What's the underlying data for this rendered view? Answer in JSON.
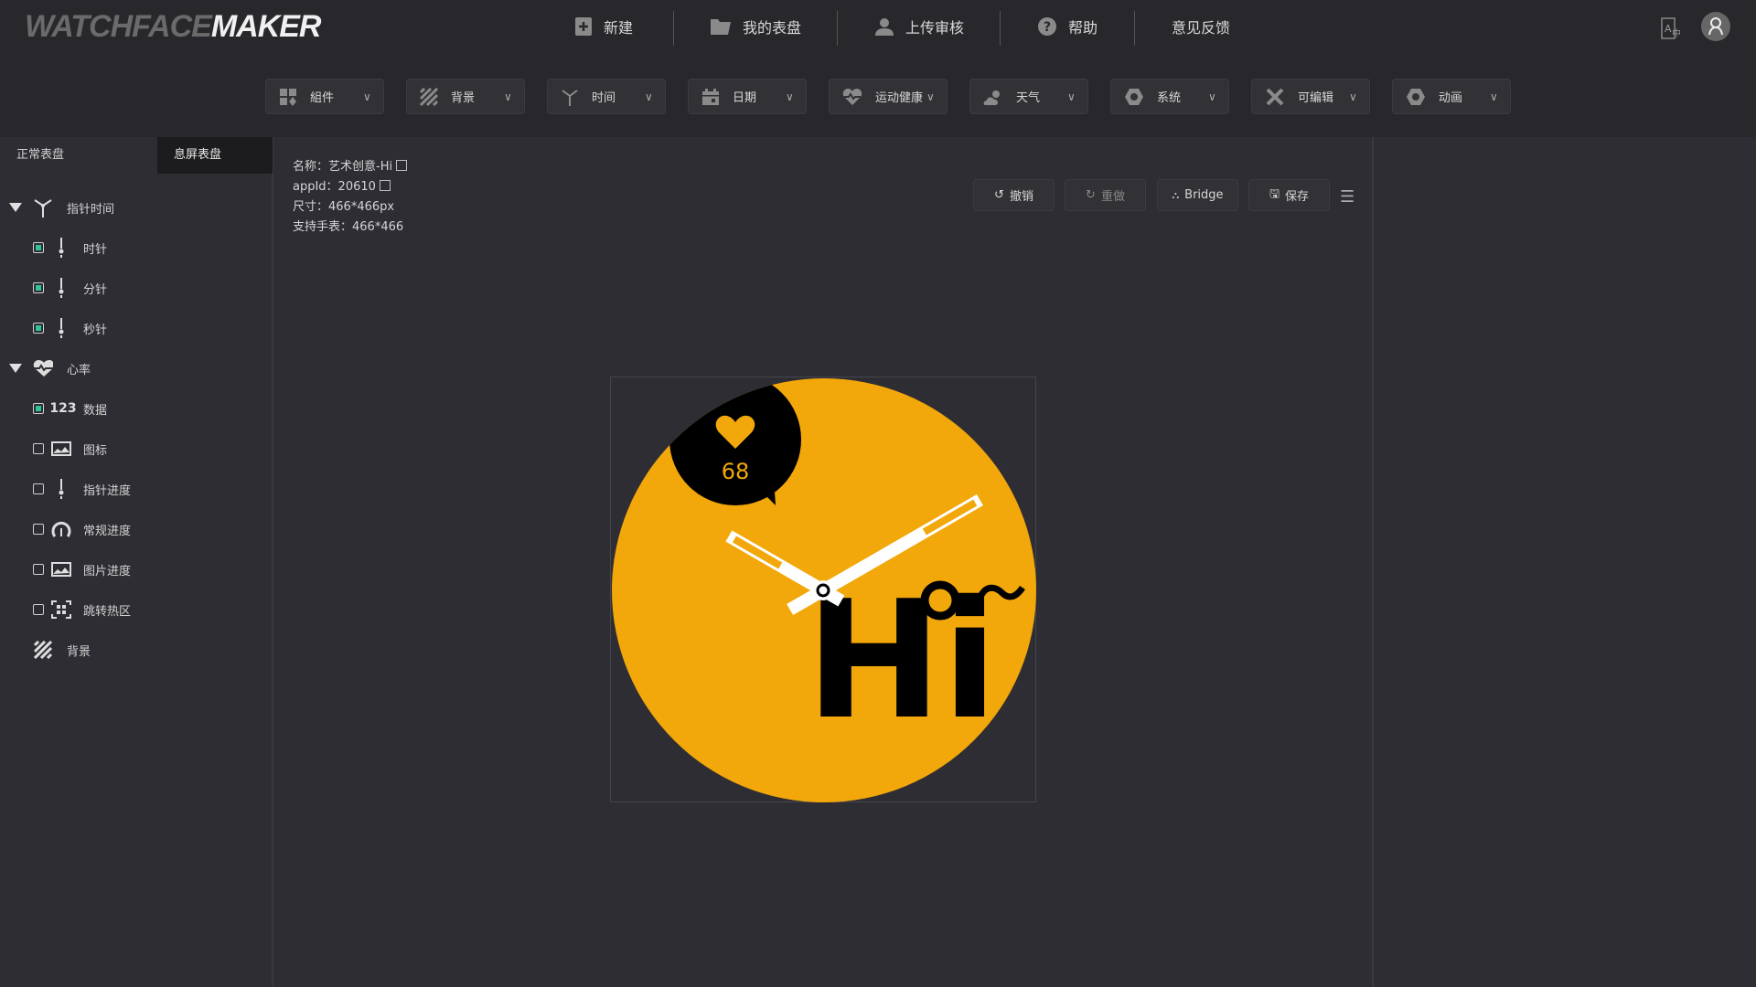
{
  "header": {
    "logo_light": "WATCHFACE",
    "logo_bold": "MAKER",
    "nav": [
      {
        "label": "新建",
        "icon": "plus-file-icon"
      },
      {
        "label": "我的表盘",
        "icon": "folder-icon"
      },
      {
        "label": "上传审核",
        "icon": "user-icon"
      },
      {
        "label": "帮助",
        "icon": "help-icon"
      },
      {
        "label": "意见反馈"
      }
    ]
  },
  "toolbar": [
    {
      "label": "組件",
      "icon": "widgets-icon"
    },
    {
      "label": "背景",
      "icon": "background-icon"
    },
    {
      "label": "时间",
      "icon": "clock-hands-icon"
    },
    {
      "label": "日期",
      "icon": "calendar-icon"
    },
    {
      "label": "运动健康",
      "icon": "heart-rate-icon"
    },
    {
      "label": "天气",
      "icon": "weather-icon"
    },
    {
      "label": "系统",
      "icon": "hex-icon"
    },
    {
      "label": "可编辑",
      "icon": "tools-icon"
    },
    {
      "label": "动画",
      "icon": "hex-icon"
    }
  ],
  "tabs": {
    "normal": "正常表盘",
    "aod": "息屏表盘"
  },
  "tree": [
    {
      "label": "指针时间",
      "type": "group"
    },
    {
      "label": "时针",
      "checked": true
    },
    {
      "label": "分针",
      "checked": true
    },
    {
      "label": "秒针",
      "checked": true
    },
    {
      "label": "心率",
      "type": "group"
    },
    {
      "label": "数据",
      "checked": true,
      "icon_text": "123"
    },
    {
      "label": "图标",
      "checked": false
    },
    {
      "label": "指针进度",
      "checked": false
    },
    {
      "label": "常规进度",
      "checked": false
    },
    {
      "label": "图片进度",
      "checked": false
    },
    {
      "label": "跳转热区",
      "checked": false
    },
    {
      "label": "背景",
      "type": "group"
    }
  ],
  "info": {
    "name": "名称：艺术创意-Hi",
    "appid": "appId：20610",
    "size": "尺寸：466*466px",
    "support": "支持手表：466*466"
  },
  "actions": {
    "undo": "撤销",
    "redo": "重做",
    "bridge": "Bridge",
    "save": "保存"
  },
  "watch": {
    "heart_rate": "68",
    "text": "Hi",
    "tilde": "~",
    "bg": "#f2a70b"
  }
}
